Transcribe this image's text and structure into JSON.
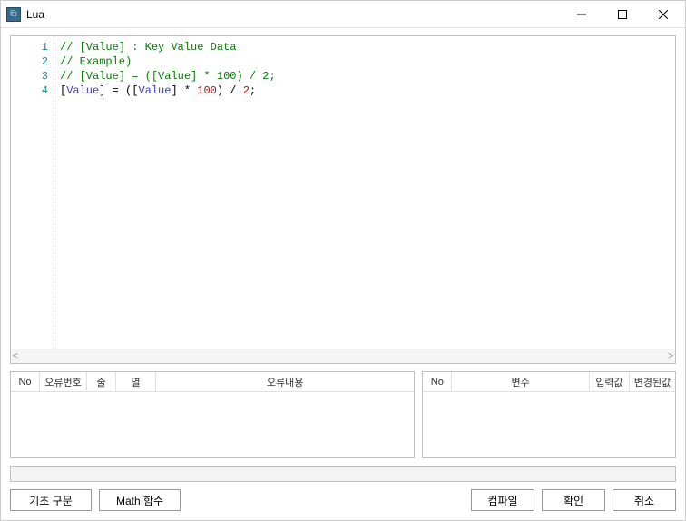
{
  "window": {
    "title": "Lua"
  },
  "editor": {
    "lines": [
      {
        "n": 1,
        "tokens": [
          {
            "t": "// ",
            "c": "comment"
          },
          {
            "t": "[Value]",
            "c": "comment"
          },
          {
            "t": " : Key Value Data",
            "c": "comment"
          }
        ]
      },
      {
        "n": 2,
        "tokens": [
          {
            "t": "// Example)",
            "c": "comment"
          }
        ]
      },
      {
        "n": 3,
        "tokens": [
          {
            "t": "// ",
            "c": "comment"
          },
          {
            "t": "[Value]",
            "c": "comment"
          },
          {
            "t": " = (",
            "c": "comment"
          },
          {
            "t": "[Value]",
            "c": "comment"
          },
          {
            "t": " * ",
            "c": "comment"
          },
          {
            "t": "100",
            "c": "comment"
          },
          {
            "t": ") / ",
            "c": "comment"
          },
          {
            "t": "2",
            "c": "comment"
          },
          {
            "t": ";",
            "c": "comment"
          }
        ]
      },
      {
        "n": 4,
        "tokens": [
          {
            "t": "[",
            "c": "bracket"
          },
          {
            "t": "Value",
            "c": "var"
          },
          {
            "t": "]",
            "c": "bracket"
          },
          {
            "t": " = (",
            "c": "op"
          },
          {
            "t": "[",
            "c": "bracket"
          },
          {
            "t": "Value",
            "c": "var"
          },
          {
            "t": "]",
            "c": "bracket"
          },
          {
            "t": " * ",
            "c": "op"
          },
          {
            "t": "100",
            "c": "num"
          },
          {
            "t": ") / ",
            "c": "op"
          },
          {
            "t": "2",
            "c": "num"
          },
          {
            "t": ";",
            "c": "op"
          }
        ]
      }
    ]
  },
  "errorTable": {
    "headers": {
      "no": "No",
      "errno": "오류번호",
      "line": "줄",
      "col": "열",
      "msg": "오류내용"
    }
  },
  "varTable": {
    "headers": {
      "no": "No",
      "var": "변수",
      "input": "입력값",
      "changed": "변경된값"
    }
  },
  "buttons": {
    "basic": "기초 구문",
    "math": "Math 함수",
    "compile": "컴파일",
    "ok": "확인",
    "cancel": "취소"
  }
}
